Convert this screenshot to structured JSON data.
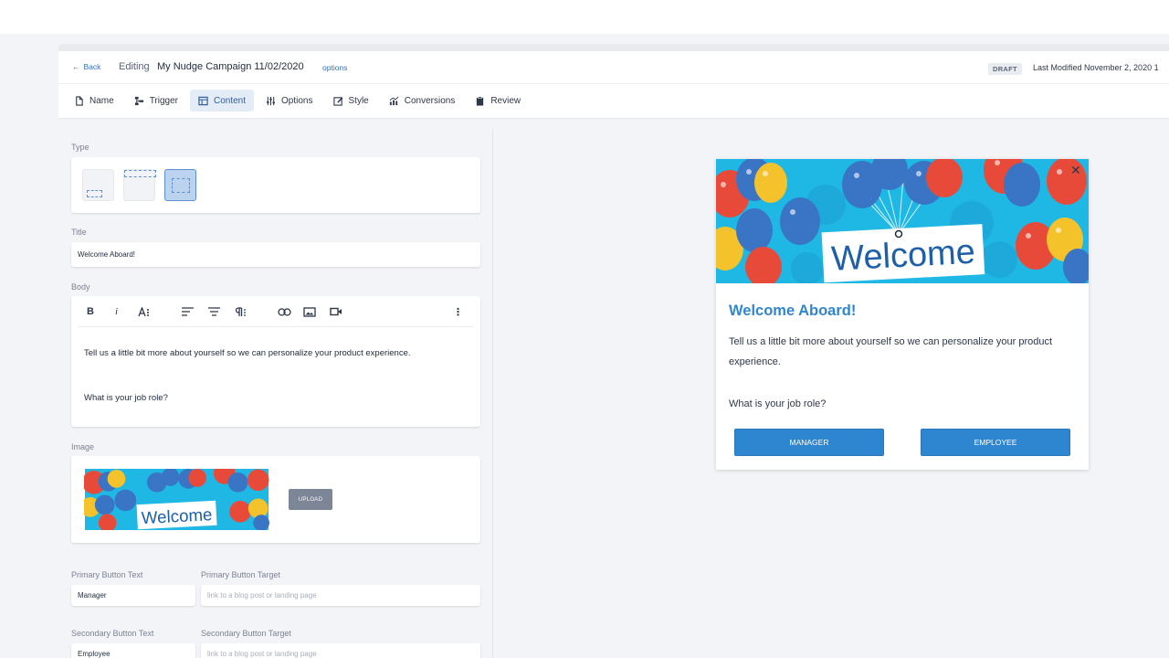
{
  "header": {
    "back_label": "Back",
    "editing_label": "Editing",
    "campaign_name": "My Nudge Campaign 11/02/2020",
    "options_label": "options",
    "status_badge": "DRAFT",
    "last_modified": "Last Modified November 2, 2020 1"
  },
  "tabs": [
    {
      "label": "Name",
      "icon": "file-icon"
    },
    {
      "label": "Trigger",
      "icon": "trigger-icon"
    },
    {
      "label": "Content",
      "icon": "table-icon"
    },
    {
      "label": "Options",
      "icon": "sliders-icon"
    },
    {
      "label": "Style",
      "icon": "edit-icon"
    },
    {
      "label": "Conversions",
      "icon": "chart-icon"
    },
    {
      "label": "Review",
      "icon": "clipboard-icon"
    }
  ],
  "active_tab": "Content",
  "form": {
    "type_label": "Type",
    "title_label": "Title",
    "title_value": "Welcome Aboard!",
    "body_label": "Body",
    "body_line1": "Tell us a little bit more about yourself so we can personalize your product experience.",
    "body_line2": "What is your job role?",
    "image_label": "Image",
    "upload_label": "UPLOAD",
    "primary_text_label": "Primary Button Text",
    "primary_text_value": "Manager",
    "primary_target_label": "Primary Button Target",
    "primary_target_placeholder": "link to a blog post or landing page",
    "secondary_text_label": "Secondary Button Text",
    "secondary_text_value": "Employee",
    "secondary_target_label": "Secondary Button Target",
    "secondary_target_placeholder": "link to a blog post or landing page"
  },
  "banner_text": "Welcome",
  "preview": {
    "title": "Welcome Aboard!",
    "body": "Tell us a little bit more about yourself so we can personalize your product experience.",
    "question": "What is your job role?",
    "primary_button": "MANAGER",
    "secondary_button": "EMPLOYEE"
  },
  "colors": {
    "accent": "#2f86d0",
    "banner_bg": "#1fb8e4"
  }
}
